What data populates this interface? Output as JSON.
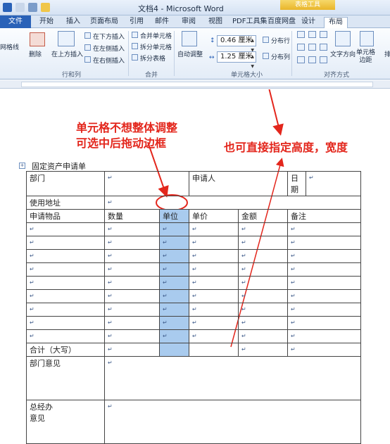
{
  "window": {
    "title": "文档4 - Microsoft Word",
    "context_tag": "表格工具"
  },
  "tabs": [
    "文件",
    "开始",
    "插入",
    "页面布局",
    "引用",
    "邮件",
    "审阅",
    "视图",
    "PDF工具集",
    "百度网盘",
    "设计",
    "布局"
  ],
  "ribbon": {
    "left_partial": "网格线",
    "delete": "删除",
    "insert_above": "在上方插入",
    "insert_below": "在下方插入",
    "insert_left": "在左侧插入",
    "insert_right": "在右侧插入",
    "rows_cols_label": "行和列",
    "merge_cells": "合并单元格",
    "split_cells": "拆分单元格",
    "split_table": "拆分表格",
    "merge_label": "合并",
    "autofit": "自动调整",
    "height_value": "0.46 厘米",
    "width_value": "1.25 厘米",
    "distribute_rows": "分布行",
    "distribute_cols": "分布列",
    "cell_size_label": "单元格大小",
    "text_direction": "文字方向",
    "cell_margins": "单元格\n边距",
    "alignment_label": "对齐方式",
    "sort_partial": "排"
  },
  "annotations": {
    "left_line1": "单元格不想整体调整",
    "left_line2": "可选中后拖动边框",
    "right": "也可直接指定高度，宽度"
  },
  "document": {
    "title": "固定资产申请单",
    "row1": {
      "dept": "部门",
      "applicant": "申请人",
      "date": "日期"
    },
    "row2": {
      "address": "使用地址"
    },
    "headers": [
      "申请物品",
      "数量",
      "单位",
      "单价",
      "金额",
      "备注"
    ],
    "total": "合计（大写）",
    "dept_opinion": "部门意见",
    "gm_opinion_l1": "总经办",
    "gm_opinion_l2": "意见"
  },
  "colors": {
    "annotation": "#e3261c",
    "selected_column": "#a9cbee",
    "file_tab": "#2a62b8"
  }
}
